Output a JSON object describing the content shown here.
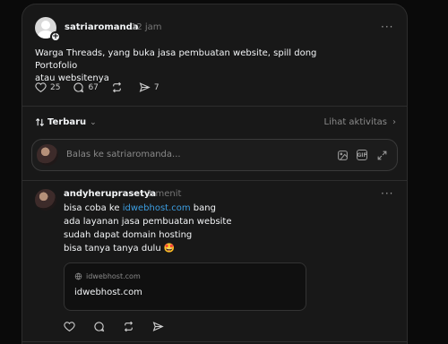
{
  "post": {
    "username": "satriaromanda",
    "time": "12 jam",
    "more": "···",
    "text_line1": "Warga Threads, yang buka jasa pembuatan website, spill dong Portofolio",
    "text_line2": "atau websitenya",
    "likes": "25",
    "comments": "67",
    "shares": "7"
  },
  "sort": {
    "label": "Terbaru",
    "activity": "Lihat aktivitas"
  },
  "reply": {
    "placeholder": "Balas ke satriaromanda..."
  },
  "comment": {
    "username": "andyheruprasetya",
    "time": "1 menit",
    "more": "···",
    "line1_prefix": "bisa coba ke ",
    "line1_link": "idwebhost.com",
    "line1_suffix": " bang",
    "line2": "ada layanan jasa pembuatan website",
    "line3": "sudah dapat domain hosting",
    "line4": "bisa tanya tanya dulu 🤩",
    "link_domain": "idwebhost.com",
    "link_title": "idwebhost.com"
  },
  "colors": {
    "background": "#0a0a0a",
    "card": "#181818",
    "link": "#3c9de0"
  }
}
